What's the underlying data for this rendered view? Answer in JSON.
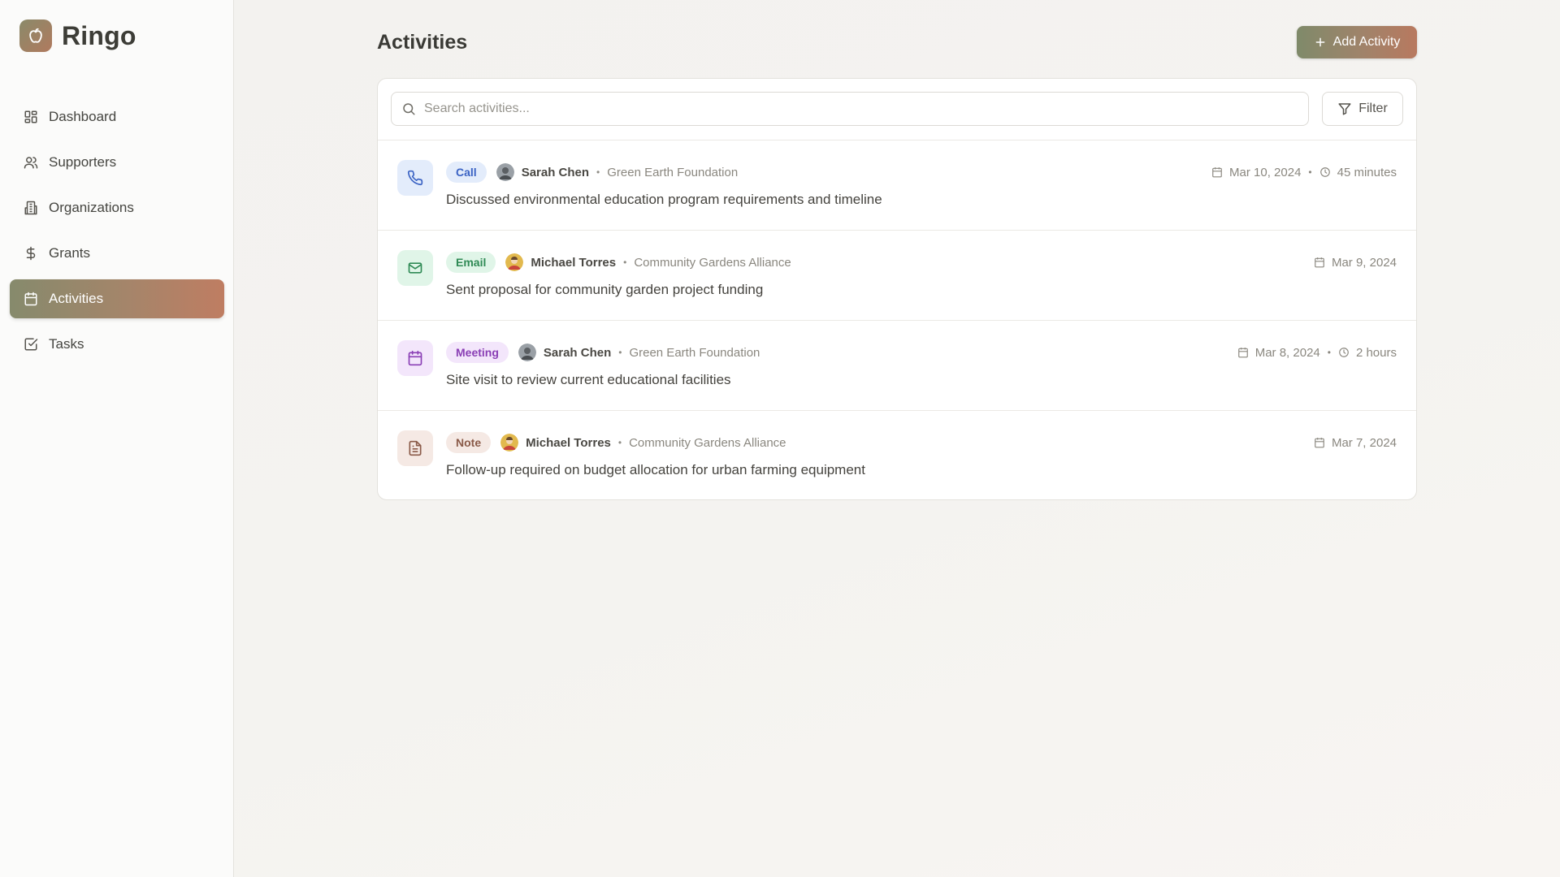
{
  "app": {
    "name": "Ringo"
  },
  "sidebar": {
    "items": [
      {
        "label": "Dashboard",
        "icon": "dashboard-icon",
        "active": false
      },
      {
        "label": "Supporters",
        "icon": "users-icon",
        "active": false
      },
      {
        "label": "Organizations",
        "icon": "building-icon",
        "active": false
      },
      {
        "label": "Grants",
        "icon": "dollar-icon",
        "active": false
      },
      {
        "label": "Activities",
        "icon": "calendar-icon",
        "active": true
      },
      {
        "label": "Tasks",
        "icon": "checkbox-icon",
        "active": false
      }
    ]
  },
  "header": {
    "title": "Activities",
    "add_button": "Add Activity"
  },
  "search": {
    "placeholder": "Search activities...",
    "value": ""
  },
  "filter": {
    "label": "Filter"
  },
  "colors": {
    "accent_start": "#868a6c",
    "accent_end": "#bf7d62",
    "call": "#3b63c4",
    "email": "#2f8a55",
    "meeting": "#8a3fb5",
    "note": "#8a5a48"
  },
  "activities": [
    {
      "type": "Call",
      "icon": "phone-icon",
      "person": "Sarah Chen",
      "org": "Green Earth Foundation",
      "description": "Discussed environmental education program requirements and timeline",
      "date": "Mar 10, 2024",
      "duration": "45 minutes"
    },
    {
      "type": "Email",
      "icon": "mail-icon",
      "person": "Michael Torres",
      "org": "Community Gardens Alliance",
      "description": "Sent proposal for community garden project funding",
      "date": "Mar 9, 2024",
      "duration": null
    },
    {
      "type": "Meeting",
      "icon": "calendar-icon",
      "person": "Sarah Chen",
      "org": "Green Earth Foundation",
      "description": "Site visit to review current educational facilities",
      "date": "Mar 8, 2024",
      "duration": "2 hours"
    },
    {
      "type": "Note",
      "icon": "document-icon",
      "person": "Michael Torres",
      "org": "Community Gardens Alliance",
      "description": "Follow-up required on budget allocation for urban farming equipment",
      "date": "Mar 7, 2024",
      "duration": null
    }
  ]
}
